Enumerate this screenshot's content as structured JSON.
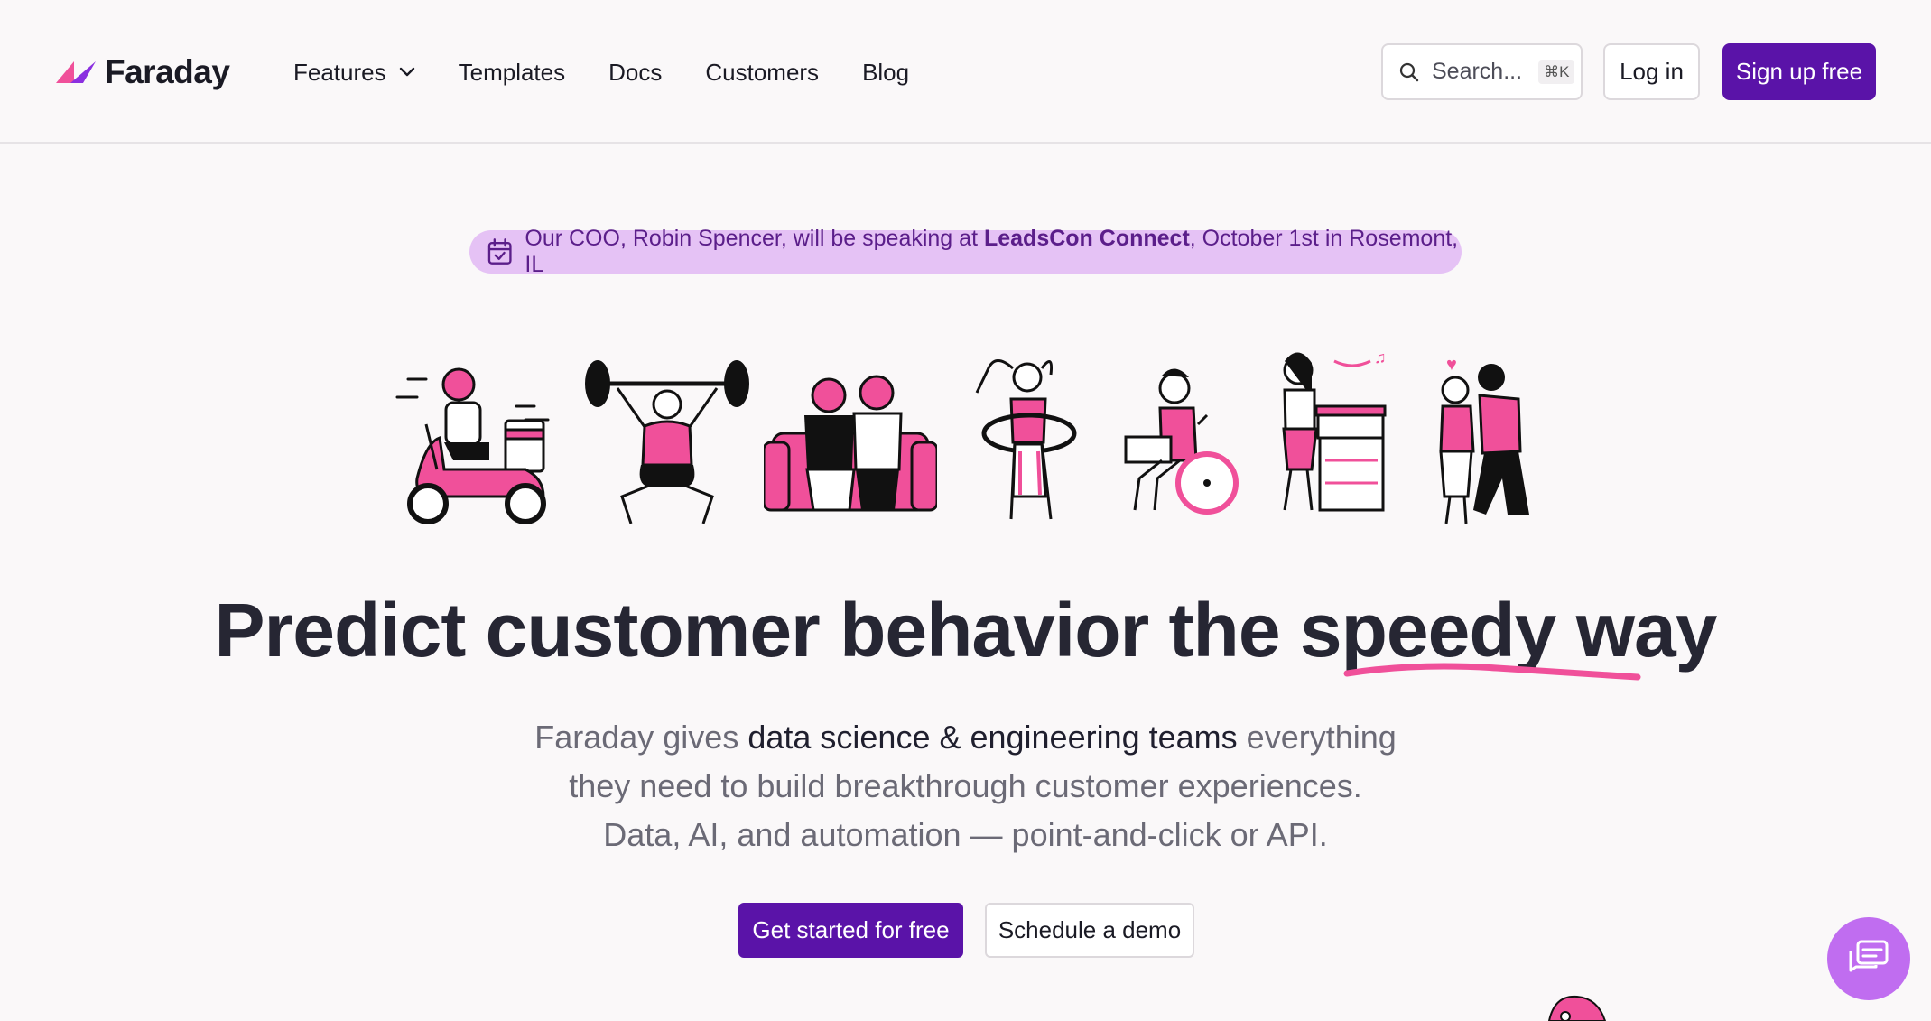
{
  "header": {
    "brand": "Faraday",
    "nav": {
      "features": "Features",
      "templates": "Templates",
      "docs": "Docs",
      "customers": "Customers",
      "blog": "Blog"
    },
    "search": {
      "placeholder": "Search...",
      "shortcut": "⌘K"
    },
    "login_label": "Log in",
    "signup_label": "Sign up free"
  },
  "announcement": {
    "prefix": "Our COO, Robin Spencer, will be speaking at ",
    "event": "LeadsCon Connect",
    "suffix": ", October 1st in Rosemont, IL"
  },
  "hero": {
    "title_before": "Predict customer behavior the ",
    "title_highlight": "speedy",
    "title_after": " way",
    "sub_line1_a": "Faraday gives ",
    "sub_line1_strong": "data science & engineering teams",
    "sub_line1_b": " everything",
    "sub_line2": "they need to build breakthrough customer experiences.",
    "sub_line3": "Data, AI, and automation — point-and-click or API.",
    "cta_primary": "Get started for free",
    "cta_secondary": "Schedule a demo"
  },
  "colors": {
    "brand_purple": "#5a13a8",
    "accent_pink": "#f0509a",
    "announce_bg": "#e5c2f5",
    "chat_bg": "#c06df0"
  },
  "icons": {
    "logo": "faraday-logo-icon",
    "features_dropdown": "chevron-down-icon",
    "search": "search-icon",
    "announcement": "calendar-check-icon",
    "chat": "chat-bubble-icon"
  }
}
